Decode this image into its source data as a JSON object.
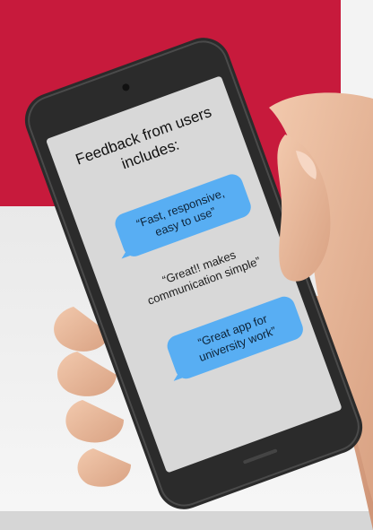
{
  "feedback": {
    "heading_line1": "Feedback from users",
    "heading_line2": "includes:",
    "quote1_line1": "“Fast, responsive,",
    "quote1_line2": "easy to use”",
    "quote2_line1": "“Great!! makes",
    "quote2_line2": "communication simple”",
    "quote3_line1": "“Great app for",
    "quote3_line2": "university work”"
  },
  "colors": {
    "brand_red": "#c71a3c",
    "bubble_blue": "#58aef3",
    "screen_grey": "#d8d8d8",
    "phone_body": "#2b2b2b"
  }
}
